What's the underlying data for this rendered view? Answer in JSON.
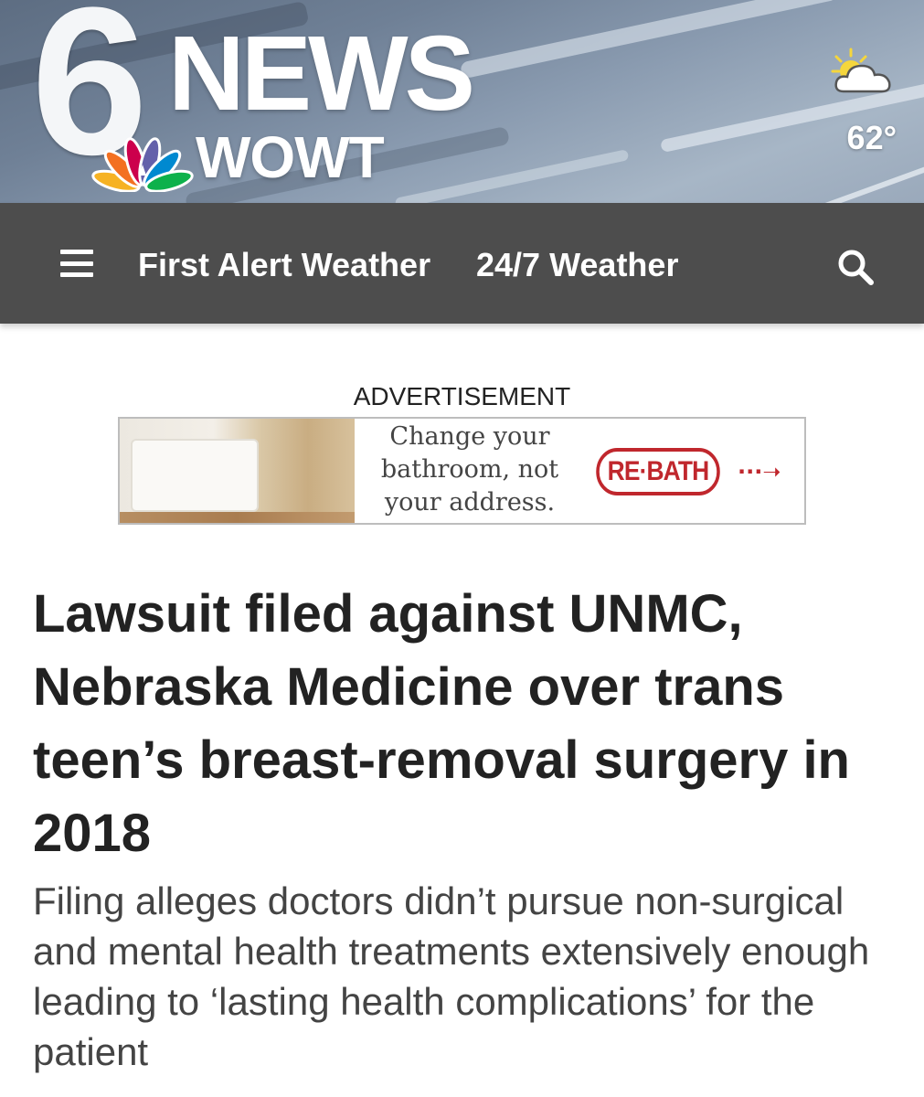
{
  "brand": {
    "logo_number": "6",
    "logo_news": "NEWS",
    "logo_station": "WOWT"
  },
  "weather": {
    "icon": "partly-cloudy-icon",
    "temperature": "62°"
  },
  "nav": {
    "menu_icon": "hamburger-menu-icon",
    "links": [
      "First Alert Weather",
      "24/7 Weather"
    ],
    "search_icon": "search-icon"
  },
  "advertisement": {
    "label": "ADVERTISEMENT",
    "copy_lines": [
      "Change your",
      "bathroom, not",
      "your address."
    ],
    "brand": "RE·BATH",
    "arrow": "···➝"
  },
  "article": {
    "headline": "Lawsuit filed against UNMC, Nebraska Medicine over trans teen’s breast-removal surgery in 2018",
    "subheadline": "Filing alleges doctors didn’t pursue non-surgical and mental health treatments extensively enough leading to ‘lasting health complications’ for the patient"
  },
  "colors": {
    "nav_background": "#4d4d4d",
    "rebath_red": "#c0272d",
    "headline_text": "#222222",
    "subhead_text": "#444444"
  }
}
